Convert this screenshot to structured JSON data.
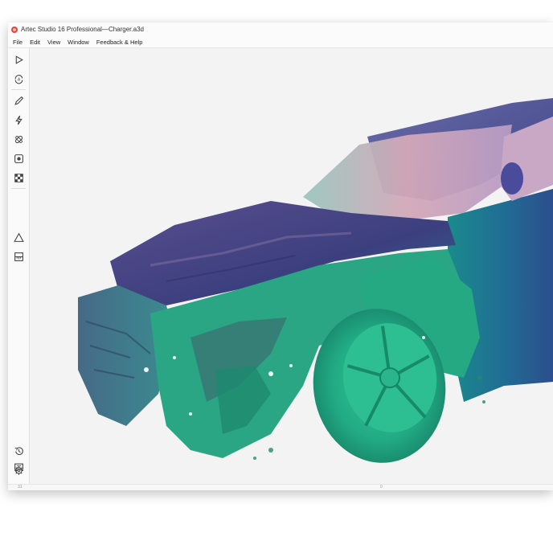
{
  "window": {
    "title": "Artec Studio 16 Professional—Charger.a3d"
  },
  "menu": {
    "items": [
      "File",
      "Edit",
      "View",
      "Window",
      "Feedback & Help"
    ]
  },
  "toolbar": {
    "tools": [
      {
        "name": "play-icon"
      },
      {
        "name": "autopilot-icon"
      },
      {
        "name": "pencil-icon"
      },
      {
        "name": "lightning-icon"
      },
      {
        "name": "bandage-icon"
      },
      {
        "name": "target-square-icon"
      },
      {
        "name": "texture-checker-icon"
      },
      {
        "name": "triangle-icon"
      },
      {
        "name": "ruler-icon"
      },
      {
        "name": "history-icon"
      },
      {
        "name": "gear-icon"
      },
      {
        "name": "chat-icon"
      }
    ]
  },
  "status": {
    "left": "31",
    "center": "0"
  },
  "colors": {
    "accent": "#e0463c",
    "background": "#f3f3f3",
    "scan_green": "#27b98a",
    "scan_purple": "#5a5a9e",
    "scan_teal": "#1f7d93",
    "scan_pink": "#cfa6b6"
  }
}
